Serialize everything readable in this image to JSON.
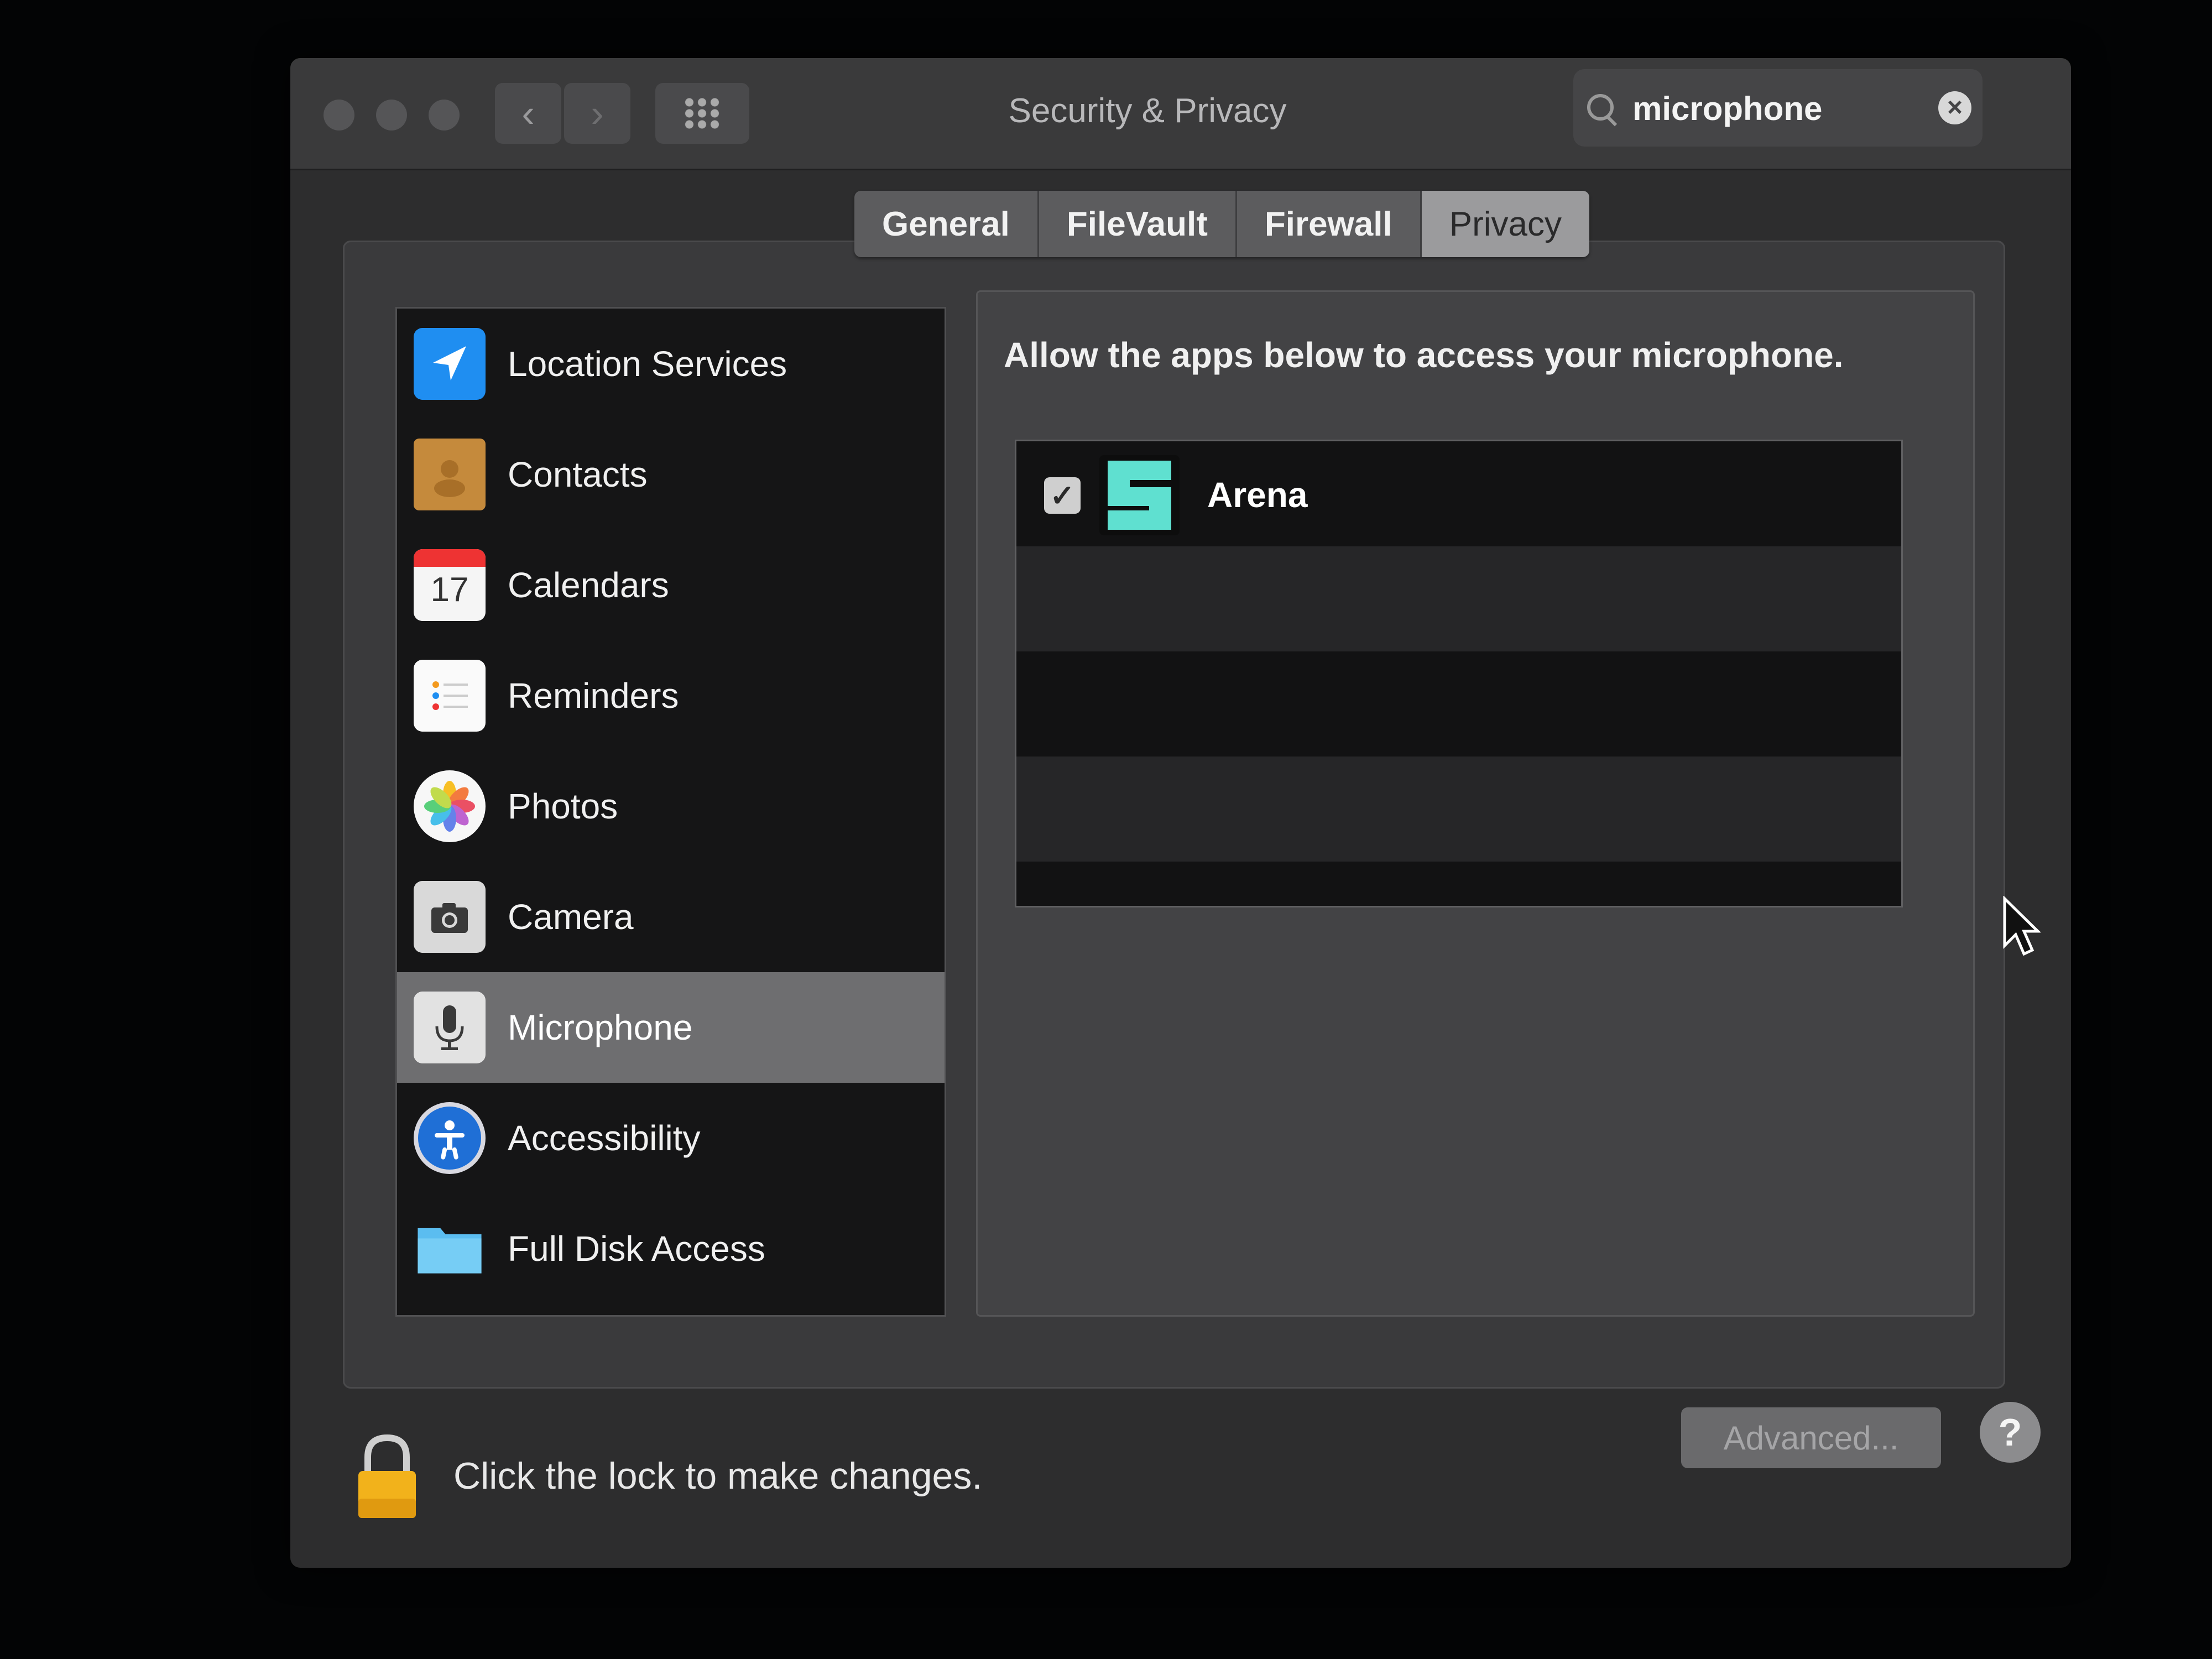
{
  "window": {
    "title": "Security & Privacy",
    "nav_back": "‹",
    "nav_forward": "›"
  },
  "search": {
    "value": "microphone",
    "clear_icon": "×"
  },
  "tabs": [
    {
      "label": "General",
      "active": false
    },
    {
      "label": "FileVault",
      "active": false
    },
    {
      "label": "Firewall",
      "active": false
    },
    {
      "label": "Privacy",
      "active": true
    }
  ],
  "sidebar": {
    "items": [
      {
        "label": "Location Services",
        "icon": "location-arrow-icon"
      },
      {
        "label": "Contacts",
        "icon": "contacts-book-icon"
      },
      {
        "label": "Calendars",
        "icon": "calendar-icon",
        "badge": "17"
      },
      {
        "label": "Reminders",
        "icon": "reminders-icon"
      },
      {
        "label": "Photos",
        "icon": "photos-pinwheel-icon"
      },
      {
        "label": "Camera",
        "icon": "camera-icon"
      },
      {
        "label": "Microphone",
        "icon": "microphone-icon",
        "selected": true
      },
      {
        "label": "Accessibility",
        "icon": "accessibility-icon"
      },
      {
        "label": "Full Disk Access",
        "icon": "folder-icon"
      }
    ]
  },
  "panel": {
    "prompt": "Allow the apps below to access your microphone.",
    "apps": [
      {
        "name": "Arena",
        "checked": true,
        "check_glyph": "✓",
        "icon": "arena-app-icon"
      }
    ]
  },
  "footer": {
    "lock_text": "Click the lock to make changes.",
    "advanced_label": "Advanced...",
    "help_label": "?"
  },
  "colors": {
    "window_bg": "#2d2d2e",
    "selected_row": "#6e6e70",
    "arena_accent": "#5fe0d0",
    "lock_gold": "#f2b21b"
  }
}
